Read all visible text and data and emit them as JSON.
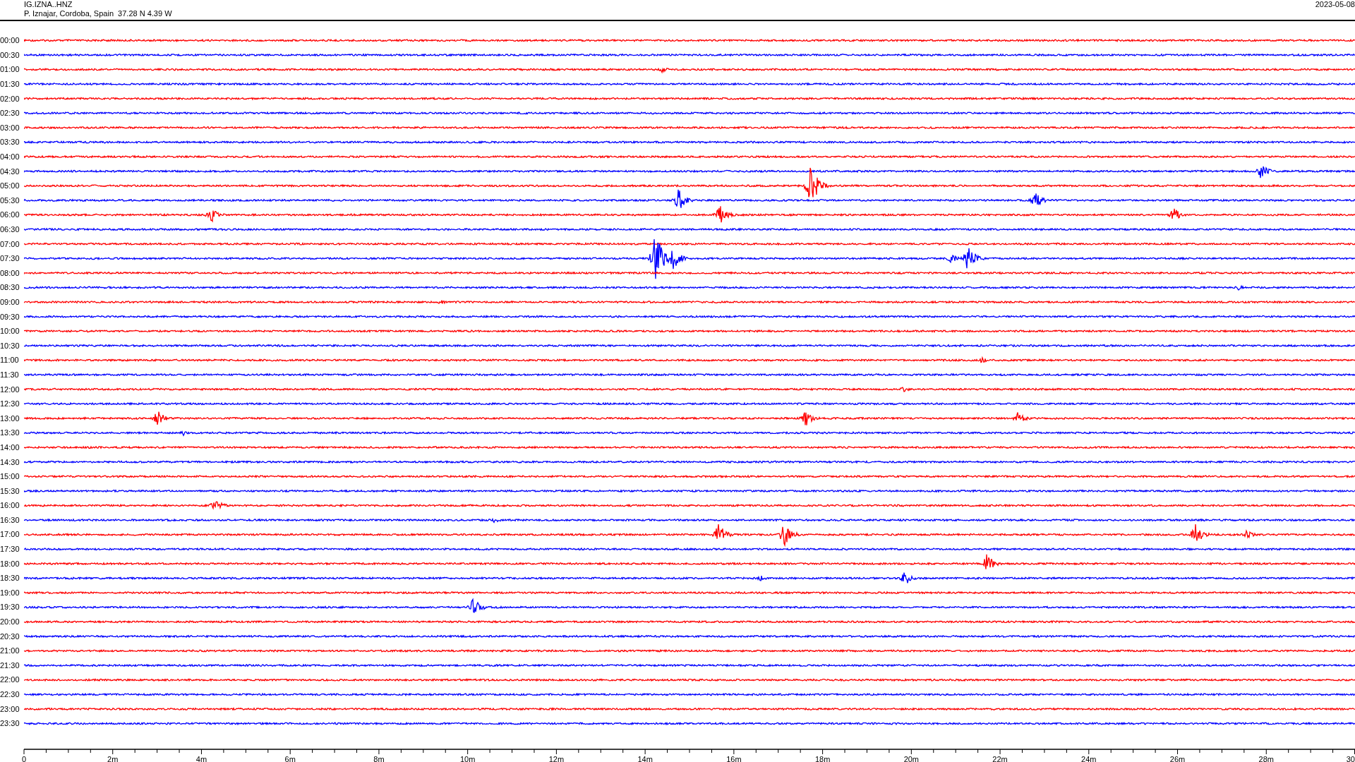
{
  "header": {
    "station": "IG.IZNA..HNZ",
    "location": "P. Iznajar, Cordoba, Spain  37.28 N 4.39 W",
    "date": "2023-05-08"
  },
  "rows": [
    {
      "label": "00:00",
      "color": "#ff0000"
    },
    {
      "label": "00:30",
      "color": "#0000ff"
    },
    {
      "label": "01:00",
      "color": "#ff0000"
    },
    {
      "label": "01:30",
      "color": "#0000ff"
    },
    {
      "label": "02:00",
      "color": "#ff0000"
    },
    {
      "label": "02:30",
      "color": "#0000ff"
    },
    {
      "label": "03:00",
      "color": "#ff0000"
    },
    {
      "label": "03:30",
      "color": "#0000ff"
    },
    {
      "label": "04:00",
      "color": "#ff0000"
    },
    {
      "label": "04:30",
      "color": "#0000ff"
    },
    {
      "label": "05:00",
      "color": "#ff0000"
    },
    {
      "label": "05:30",
      "color": "#0000ff"
    },
    {
      "label": "06:00",
      "color": "#ff0000"
    },
    {
      "label": "06:30",
      "color": "#0000ff"
    },
    {
      "label": "07:00",
      "color": "#ff0000"
    },
    {
      "label": "07:30",
      "color": "#0000ff"
    },
    {
      "label": "08:00",
      "color": "#ff0000"
    },
    {
      "label": "08:30",
      "color": "#0000ff"
    },
    {
      "label": "09:00",
      "color": "#ff0000"
    },
    {
      "label": "09:30",
      "color": "#0000ff"
    },
    {
      "label": "10:00",
      "color": "#ff0000"
    },
    {
      "label": "10:30",
      "color": "#0000ff"
    },
    {
      "label": "11:00",
      "color": "#ff0000"
    },
    {
      "label": "11:30",
      "color": "#0000ff"
    },
    {
      "label": "12:00",
      "color": "#ff0000"
    },
    {
      "label": "12:30",
      "color": "#0000ff"
    },
    {
      "label": "13:00",
      "color": "#ff0000"
    },
    {
      "label": "13:30",
      "color": "#0000ff"
    },
    {
      "label": "14:00",
      "color": "#ff0000"
    },
    {
      "label": "14:30",
      "color": "#0000ff"
    },
    {
      "label": "15:00",
      "color": "#ff0000"
    },
    {
      "label": "15:30",
      "color": "#0000ff"
    },
    {
      "label": "16:00",
      "color": "#ff0000"
    },
    {
      "label": "16:30",
      "color": "#0000ff"
    },
    {
      "label": "17:00",
      "color": "#ff0000"
    },
    {
      "label": "17:30",
      "color": "#0000ff"
    },
    {
      "label": "18:00",
      "color": "#ff0000"
    },
    {
      "label": "18:30",
      "color": "#0000ff"
    },
    {
      "label": "19:00",
      "color": "#ff0000"
    },
    {
      "label": "19:30",
      "color": "#0000ff"
    },
    {
      "label": "20:00",
      "color": "#ff0000"
    },
    {
      "label": "20:30",
      "color": "#0000ff"
    },
    {
      "label": "21:00",
      "color": "#ff0000"
    },
    {
      "label": "21:30",
      "color": "#0000ff"
    },
    {
      "label": "22:00",
      "color": "#ff0000"
    },
    {
      "label": "22:30",
      "color": "#0000ff"
    },
    {
      "label": "23:00",
      "color": "#ff0000"
    },
    {
      "label": "23:30",
      "color": "#0000ff"
    }
  ],
  "axis": {
    "tick_labels": [
      "0",
      "2m",
      "4m",
      "6m",
      "8m",
      "10m",
      "12m",
      "14m",
      "16m",
      "18m",
      "20m",
      "22m",
      "24m",
      "26m",
      "28m",
      "30"
    ]
  }
}
